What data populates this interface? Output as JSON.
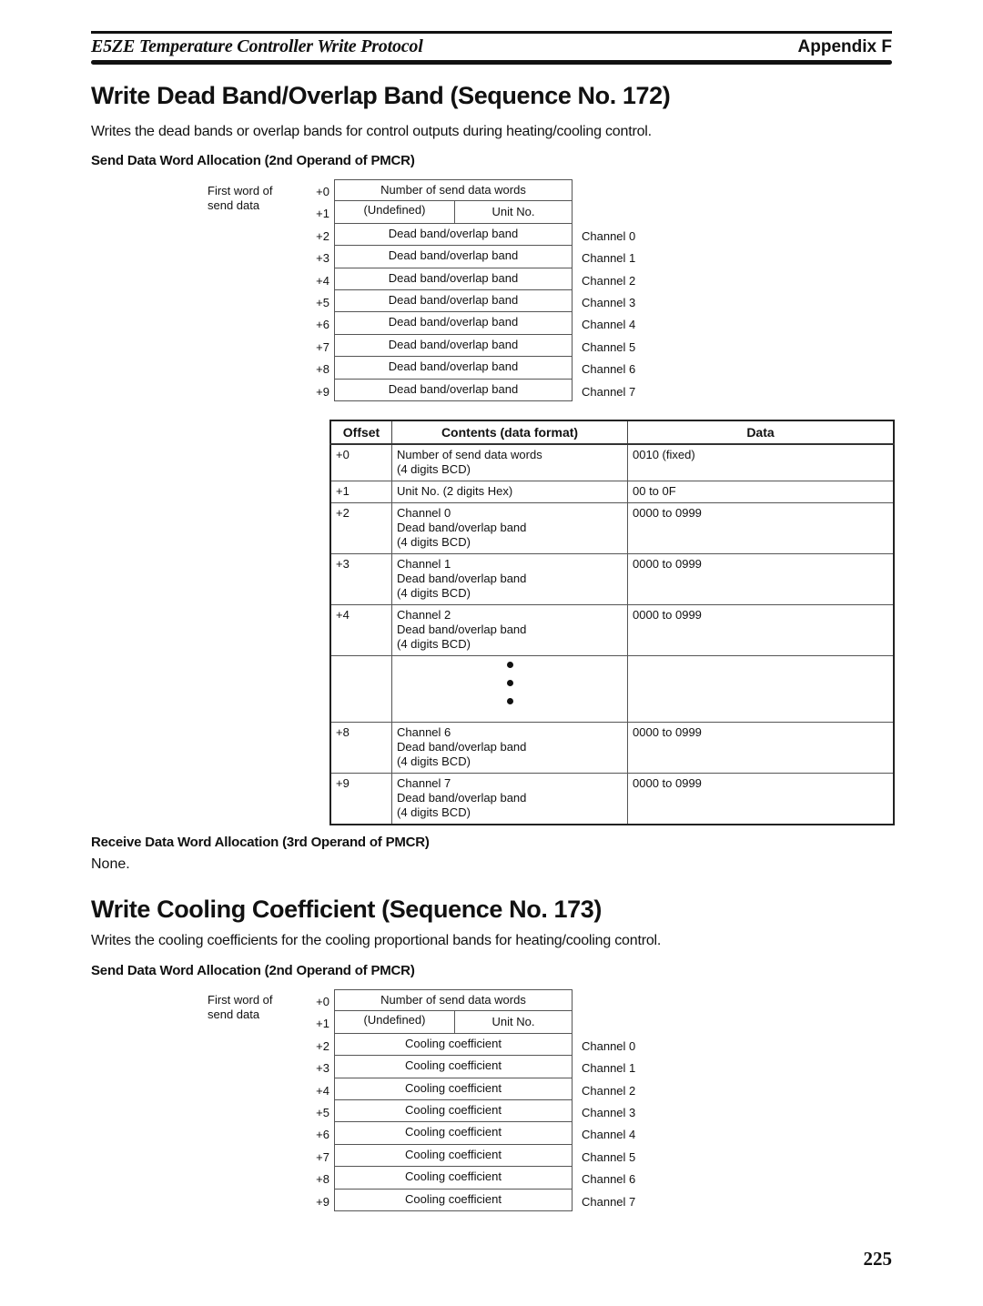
{
  "header": {
    "title": "E5ZE Temperature Controller Write Protocol",
    "appendix": "Appendix F"
  },
  "section172": {
    "title": "Write Dead Band/Overlap Band (Sequence No. 172)",
    "description": "Writes the dead bands or overlap bands for control outputs during heating/cooling control.",
    "send_heading": "Send Data Word Allocation (2nd Operand of PMCR)",
    "diagram": {
      "first_word_label": "First word of send data",
      "rows": [
        {
          "offset": "+0",
          "content": "Number of send data words",
          "channel": ""
        },
        {
          "offset": "+1",
          "undefined": "(Undefined)",
          "unit": "Unit No.",
          "channel": ""
        },
        {
          "offset": "+2",
          "content": "Dead band/overlap band",
          "channel": "Channel 0"
        },
        {
          "offset": "+3",
          "content": "Dead band/overlap band",
          "channel": "Channel 1"
        },
        {
          "offset": "+4",
          "content": "Dead band/overlap band",
          "channel": "Channel 2"
        },
        {
          "offset": "+5",
          "content": "Dead band/overlap band",
          "channel": "Channel 3"
        },
        {
          "offset": "+6",
          "content": "Dead band/overlap band",
          "channel": "Channel 4"
        },
        {
          "offset": "+7",
          "content": "Dead band/overlap band",
          "channel": "Channel 5"
        },
        {
          "offset": "+8",
          "content": "Dead band/overlap band",
          "channel": "Channel 6"
        },
        {
          "offset": "+9",
          "content": "Dead band/overlap band",
          "channel": "Channel 7"
        }
      ]
    },
    "table": {
      "headers": [
        "Offset",
        "Contents (data format)",
        "Data"
      ],
      "rows": [
        {
          "offset": "+0",
          "lines": [
            "Number of send data words",
            "(4 digits BCD)"
          ],
          "data": "0010 (fixed)"
        },
        {
          "offset": "+1",
          "lines": [
            "Unit No. (2 digits Hex)"
          ],
          "data": "00 to 0F"
        },
        {
          "offset": "+2",
          "lines": [
            "Channel 0",
            "Dead band/overlap band",
            "(4 digits BCD)"
          ],
          "data": "0000 to 0999"
        },
        {
          "offset": "+3",
          "lines": [
            "Channel 1",
            "Dead band/overlap band",
            "(4 digits BCD)"
          ],
          "data": "0000 to 0999"
        },
        {
          "offset": "+4",
          "lines": [
            "Channel 2",
            "Dead band/overlap band",
            "(4 digits BCD)"
          ],
          "data": "0000 to 0999"
        },
        {
          "offset": "+8",
          "lines": [
            "Channel 6",
            "Dead band/overlap band",
            "(4 digits BCD)"
          ],
          "data": "0000 to 0999"
        },
        {
          "offset": "+9",
          "lines": [
            "Channel 7",
            "Dead band/overlap band",
            "(4 digits BCD)"
          ],
          "data": "0000 to 0999"
        }
      ]
    },
    "receive_heading": "Receive Data Word Allocation (3rd Operand of PMCR)",
    "receive_text": "None."
  },
  "section173": {
    "title": "Write Cooling Coefficient (Sequence No. 173)",
    "description": "Writes the cooling coefficients for the cooling proportional bands for heating/cooling control.",
    "send_heading": "Send Data Word Allocation (2nd Operand of PMCR)",
    "diagram": {
      "first_word_label": "First word of send data",
      "rows": [
        {
          "offset": "+0",
          "content": "Number of send data words",
          "channel": ""
        },
        {
          "offset": "+1",
          "undefined": "(Undefined)",
          "unit": "Unit No.",
          "channel": ""
        },
        {
          "offset": "+2",
          "content": "Cooling coefficient",
          "channel": "Channel 0"
        },
        {
          "offset": "+3",
          "content": "Cooling coefficient",
          "channel": "Channel 1"
        },
        {
          "offset": "+4",
          "content": "Cooling coefficient",
          "channel": "Channel 2"
        },
        {
          "offset": "+5",
          "content": "Cooling coefficient",
          "channel": "Channel 3"
        },
        {
          "offset": "+6",
          "content": "Cooling coefficient",
          "channel": "Channel 4"
        },
        {
          "offset": "+7",
          "content": "Cooling coefficient",
          "channel": "Channel 5"
        },
        {
          "offset": "+8",
          "content": "Cooling coefficient",
          "channel": "Channel 6"
        },
        {
          "offset": "+9",
          "content": "Cooling coefficient",
          "channel": "Channel 7"
        }
      ]
    }
  },
  "footer": {
    "page_number": "225"
  }
}
